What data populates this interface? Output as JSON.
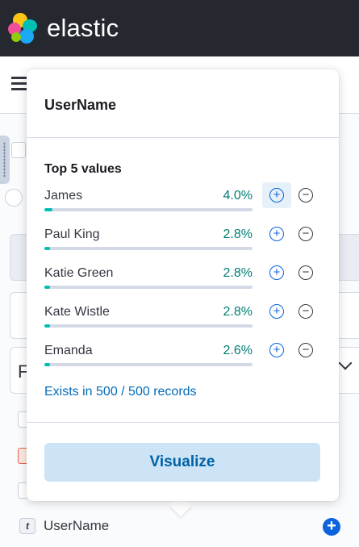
{
  "header": {
    "brand": "elastic"
  },
  "popover": {
    "title": "UserName",
    "top_values_heading": "Top 5 values",
    "values": [
      {
        "name": "James",
        "percent_label": "4.0%",
        "percent": 4.0
      },
      {
        "name": "Paul King",
        "percent_label": "2.8%",
        "percent": 2.8
      },
      {
        "name": "Katie Green",
        "percent_label": "2.8%",
        "percent": 2.8
      },
      {
        "name": "Kate Wistle",
        "percent_label": "2.8%",
        "percent": 2.8
      },
      {
        "name": "Emanda",
        "percent_label": "2.6%",
        "percent": 2.6
      }
    ],
    "exists_text": "Exists in 500 / 500 records",
    "visualize_label": "Visualize"
  },
  "field_list": {
    "field_type_token": "t",
    "field_name": "UserName"
  },
  "colors": {
    "header_bg": "#25282f",
    "percent_text": "#017d73",
    "bar_fill": "#00bfb3",
    "accent_link": "#006bb8",
    "visualize_bg": "#cce4f5"
  }
}
